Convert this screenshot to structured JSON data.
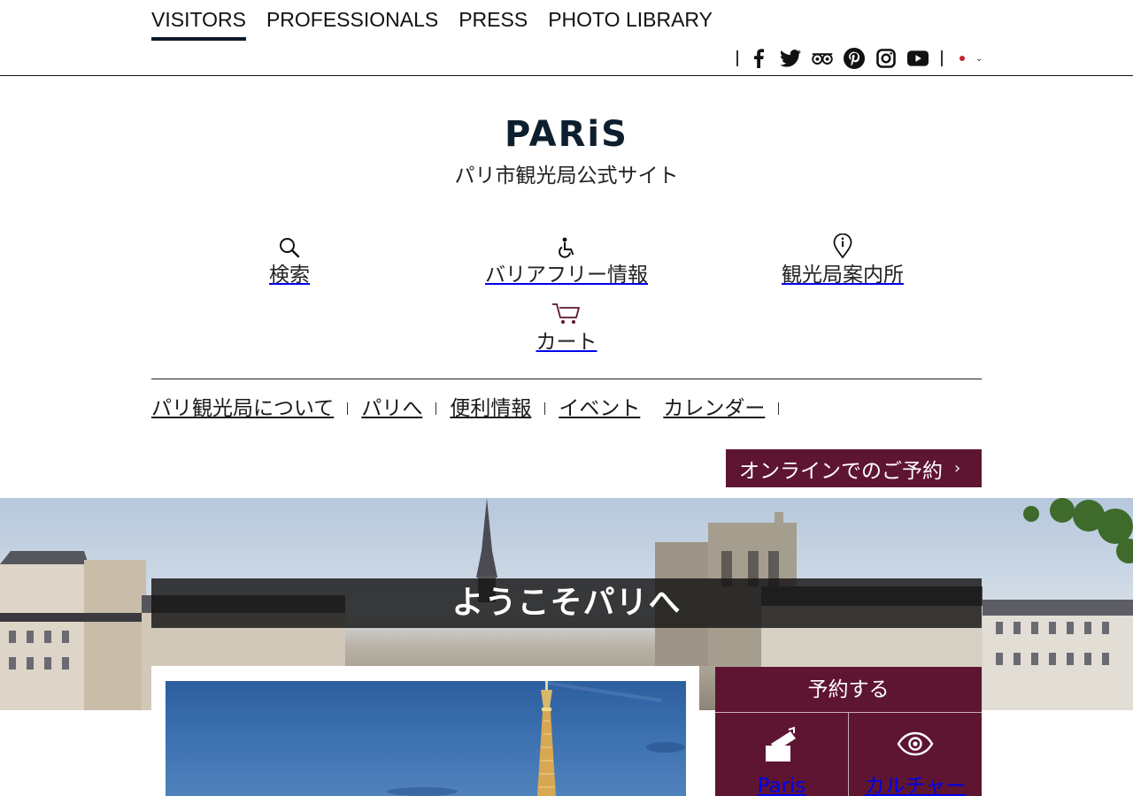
{
  "top_nav": {
    "items": [
      "VISITORS",
      "PROFESSIONALS",
      "PRESS",
      "PHOTO LIBRARY"
    ],
    "active": "VISITORS"
  },
  "social": {
    "icons": [
      "facebook-icon",
      "twitter-icon",
      "tripadvisor-icon",
      "pinterest-icon",
      "instagram-icon",
      "youtube-icon"
    ]
  },
  "language": {
    "flag_color": "#c0272d"
  },
  "logo": {
    "wordmark": "PARiS",
    "tagline": "パリ市観光局公式サイト"
  },
  "utility": {
    "search": "検索",
    "accessibility": "バリアフリー情報",
    "info_office": "観光局案内所",
    "cart": "カート"
  },
  "main_nav": {
    "items": [
      "パリ観光局について",
      "パリへ",
      "便利情報",
      "イベント",
      "カレンダー"
    ]
  },
  "cta": {
    "book_online": "オンラインでのご予約",
    "arrow": "›"
  },
  "hero": {
    "welcome": "ようこそパリへ"
  },
  "booking_panel": {
    "title": "予約する",
    "cells": [
      "Paris",
      "カルチャー"
    ]
  },
  "colors": {
    "brand": "#5e1532",
    "logo": "#0d1f2e",
    "active_underline": "#0d1a26"
  }
}
